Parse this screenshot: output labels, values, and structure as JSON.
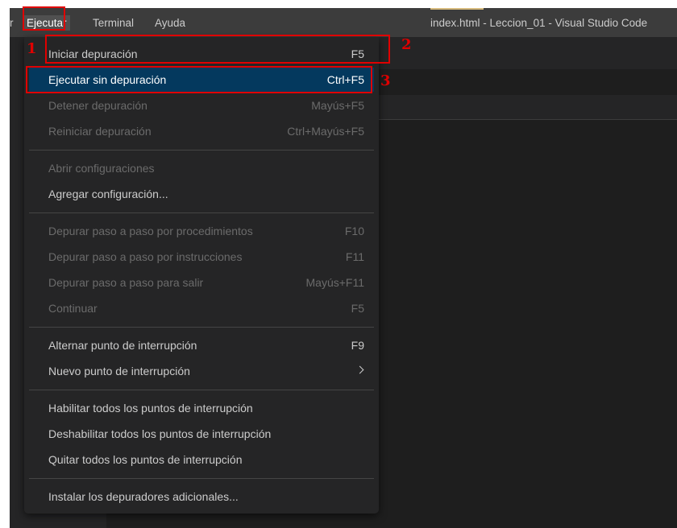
{
  "menubar": {
    "cut_item": "r",
    "items": [
      "Ejecutar",
      "Terminal",
      "Ayuda"
    ]
  },
  "window_title": "index.html - Leccion_01 - Visual Studio Code",
  "menu": {
    "groups": [
      [
        {
          "label": "Iniciar depuración",
          "shortcut": "F5",
          "enabled": true
        },
        {
          "label": "Ejecutar sin depuración",
          "shortcut": "Ctrl+F5",
          "enabled": true,
          "selected": true
        },
        {
          "label": "Detener depuración",
          "shortcut": "Mayús+F5",
          "enabled": false
        },
        {
          "label": "Reiniciar depuración",
          "shortcut": "Ctrl+Mayús+F5",
          "enabled": false
        }
      ],
      [
        {
          "label": "Abrir configuraciones",
          "shortcut": "",
          "enabled": false
        },
        {
          "label": "Agregar configuración...",
          "shortcut": "",
          "enabled": true
        }
      ],
      [
        {
          "label": "Depurar paso a paso por procedimientos",
          "shortcut": "F10",
          "enabled": false
        },
        {
          "label": "Depurar paso a paso por instrucciones",
          "shortcut": "F11",
          "enabled": false
        },
        {
          "label": "Depurar paso a paso para salir",
          "shortcut": "Mayús+F11",
          "enabled": false
        },
        {
          "label": "Continuar",
          "shortcut": "F5",
          "enabled": false
        }
      ],
      [
        {
          "label": "Alternar punto de interrupción",
          "shortcut": "F9",
          "enabled": true
        },
        {
          "label": "Nuevo punto de interrupción",
          "shortcut": "",
          "enabled": true,
          "submenu": true
        }
      ],
      [
        {
          "label": "Habilitar todos los puntos de interrupción",
          "shortcut": "",
          "enabled": true
        },
        {
          "label": "Deshabilitar todos los puntos de interrupción",
          "shortcut": "",
          "enabled": true
        },
        {
          "label": "Quitar todos los puntos de interrupción",
          "shortcut": "",
          "enabled": true
        }
      ],
      [
        {
          "label": "Instalar los depuradores adicionales...",
          "shortcut": "",
          "enabled": true
        }
      ]
    ]
  },
  "annotations": [
    "1",
    "2",
    "3"
  ],
  "colors": {
    "highlight": "#e00000",
    "selected_bg": "#04395e",
    "menu_bg": "#252526",
    "disabled_text": "#6b6b6b"
  }
}
